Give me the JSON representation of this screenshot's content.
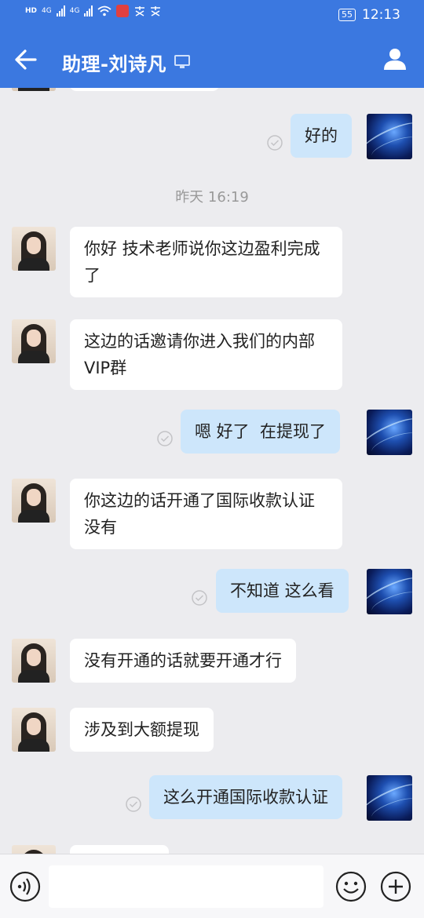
{
  "status": {
    "network_labels": [
      "HD",
      "4G",
      "4G"
    ],
    "battery": "55",
    "time": "12:13"
  },
  "header": {
    "title": "助理-刘诗凡"
  },
  "chat": {
    "timestamp": "昨天 16:19",
    "messages": [
      {
        "from": "out",
        "text": "好的"
      },
      {
        "from": "in",
        "text": "你好 技术老师说你这边盈利完成了"
      },
      {
        "from": "in",
        "text": "这边的话邀请你进入我们的内部VIP群"
      },
      {
        "from": "out",
        "text": "嗯 好了  在提现了"
      },
      {
        "from": "in",
        "text": "你这边的话开通了国际收款认证没有"
      },
      {
        "from": "out",
        "text": "不知道 这么看"
      },
      {
        "from": "in",
        "text": "没有开通的话就要开通才行"
      },
      {
        "from": "in",
        "text": "涉及到大额提现"
      },
      {
        "from": "out",
        "text": "这么开通国际收款认证"
      }
    ]
  },
  "icons": {
    "back": "arrow-left-icon",
    "profile": "person-icon",
    "pc": "computer-icon",
    "voice": "voice-icon",
    "emoji": "smiley-icon",
    "plus": "plus-icon",
    "read": "check-circle-icon"
  },
  "colors": {
    "accent": "#3b78e0",
    "bubble_out": "#cde6fb",
    "bubble_in": "#ffffff",
    "background": "#ececef"
  }
}
